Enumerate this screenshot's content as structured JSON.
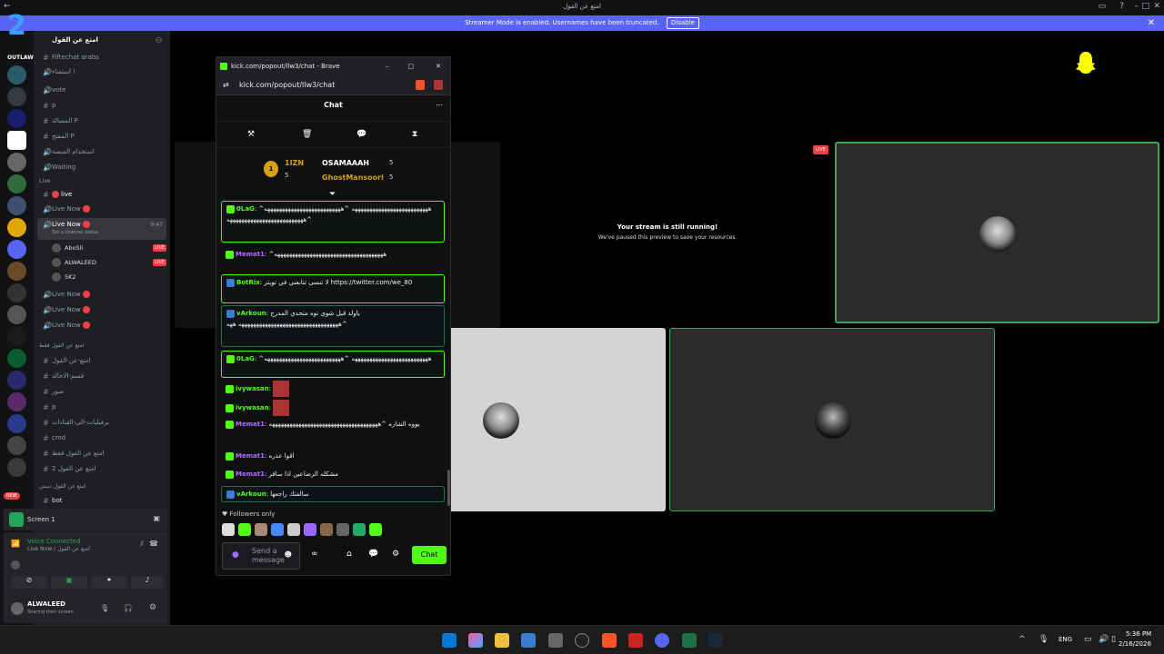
{
  "titlebar": {
    "title": "امتع عن القول"
  },
  "banner": {
    "text": "Streamer Mode is enabled. Usernames have been truncated.",
    "button": "Disable",
    "close": "✕"
  },
  "logo": {
    "text": "OUTLAW RP"
  },
  "server": {
    "name": "امتع عن القول"
  },
  "channels": {
    "top": [
      {
        "label": "Fiftechat arabs",
        "type": "text"
      },
      {
        "label": "استفتاء !",
        "type": "voice"
      },
      {
        "label": "vote",
        "type": "voice"
      },
      {
        "label": "p",
        "type": "text"
      },
      {
        "label": "المسالة P",
        "type": "text"
      },
      {
        "label": "المفتح P",
        "type": "text"
      },
      {
        "label": "استخدام المنصة",
        "type": "voice"
      },
      {
        "label": "Waiting",
        "type": "voice"
      }
    ],
    "live_category": "Live",
    "live": [
      {
        "label": "live",
        "type": "text"
      },
      {
        "label": "Live Now",
        "type": "voice"
      },
      {
        "label": "Live Now",
        "type": "voice",
        "time": "9:47",
        "status": "Set a channel status"
      }
    ],
    "users": [
      {
        "name": "AboSli",
        "badge": "LIVE"
      },
      {
        "name": "ALWALEED",
        "badge": "LIVE"
      },
      {
        "name": "5K2",
        "badge": ""
      }
    ],
    "live_more": [
      "Live Now",
      "Live Now",
      "Live Now"
    ],
    "cat2": "امتع عن القول فقط",
    "cat2_items": [
      "امتع-عن-القول",
      "قسم-الاحالة",
      "صور",
      "p",
      "برفيليات-الى-القنادات",
      "cmd",
      "امتع عن القول فقط",
      "امتع عن القول 2"
    ],
    "cat3": "امتع عن القول ديبس",
    "cat3_items": [
      "bot"
    ]
  },
  "screen_panel": {
    "label": "Screen 1"
  },
  "voice_panel": {
    "title": "Voice Connected",
    "sub": "Live Now / امتع عن القول"
  },
  "user_panel": {
    "name": "ALWALEED",
    "status": "Sharing their screen"
  },
  "new_badge": "NEW",
  "stage": {
    "live_badge": "LIVE",
    "paused_title": "Your stream is still running!",
    "paused_sub": "We've paused this preview to save your resources."
  },
  "kick": {
    "window_title": "kick.com/popout/llw3/chat - Brave",
    "url": "kick.com/popout/llw3/chat",
    "header": "Chat",
    "leaders": [
      {
        "rank": "1",
        "name": "1IZN",
        "count": "5"
      },
      {
        "name": "OSAMAAAH",
        "count": "5"
      },
      {
        "name": "GhostMansoori",
        "count": "5"
      }
    ],
    "messages": [
      {
        "user": "0LaG",
        "color": "#53fc18",
        "text": "^ههههههههههههههههههههههههههه ^ههههههههههههههههههههههههههه ^ههههههههههههههههههههههههههه",
        "style": "hl"
      },
      {
        "user": "Memat1",
        "color": "#b36bff",
        "text": "^هههههههههههههههههههههههههههههههههههههه",
        "style": ""
      },
      {
        "user": "BotRix",
        "color": "#53fc18",
        "text": "لا تنسى تتابعني في تويتر https://twitter.com/we_80",
        "style": "hl"
      },
      {
        "user": "vArkoun",
        "color": "#53fc18",
        "text": "ياولد قبل شوي توه متحدي المدرج ههههههههههههههههههههههههههههههههههه ههه^",
        "style": "hl2"
      },
      {
        "user": "0LaG",
        "color": "#53fc18",
        "text": "^ههههههههههههههههههههههههههه ^ههههههههههههههههههههههههههه",
        "style": "hl"
      },
      {
        "user": "ivywasan",
        "color": "#53fc18",
        "text": "",
        "style": ""
      },
      {
        "user": "ivywasan",
        "color": "#53fc18",
        "text": "",
        "style": ""
      },
      {
        "user": "Memat1",
        "color": "#b36bff",
        "text": "يووه الشاره ^هههههههههههههههههههههههههههههههههههههه",
        "style": ""
      },
      {
        "user": "Memat1",
        "color": "#b36bff",
        "text": "اقوا عذره",
        "style": ""
      },
      {
        "user": "Memat1",
        "color": "#b36bff",
        "text": "مشكله الرضاعين اذا سافر",
        "style": ""
      },
      {
        "user": "vArkoun",
        "color": "#53fc18",
        "text": "سالفتك راجعها",
        "style": "hl2"
      }
    ],
    "followers_only": "Followers only",
    "input_placeholder": "Send a message",
    "send_button": "Chat"
  },
  "taskbar": {
    "lang": "ENG",
    "time": "5:36 PM",
    "date": "2/16/2026"
  }
}
